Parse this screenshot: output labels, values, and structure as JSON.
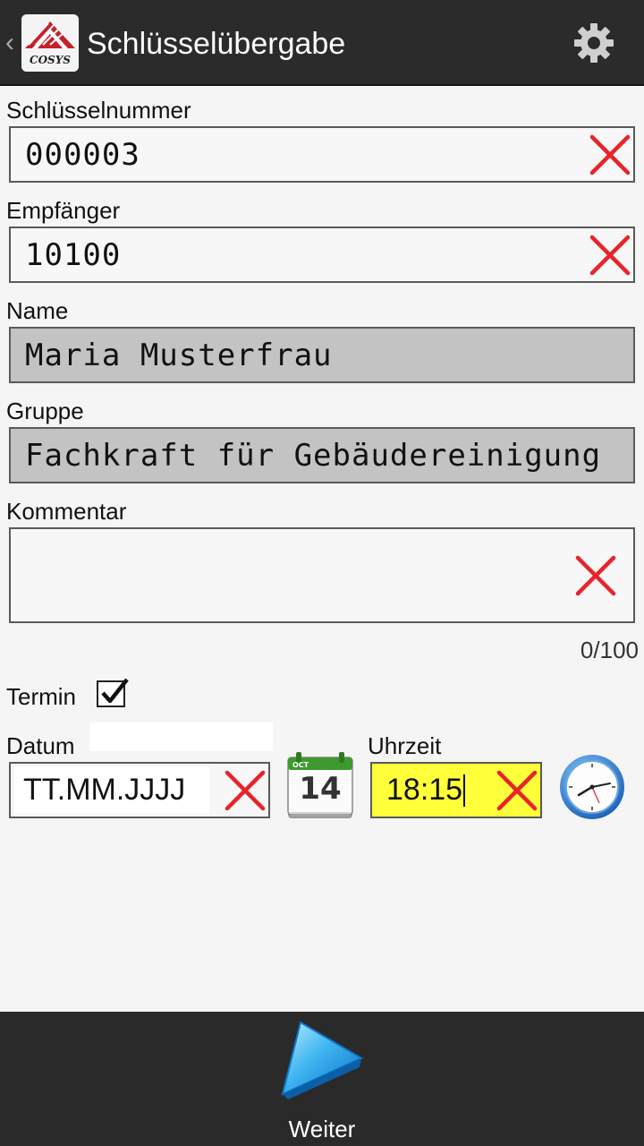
{
  "appbar": {
    "title": "Schlüsselübergabe",
    "logo_text": "COSYS"
  },
  "form": {
    "key_number": {
      "label": "Schlüsselnummer",
      "value": "000003"
    },
    "recipient": {
      "label": "Empfänger",
      "value": "10100"
    },
    "name": {
      "label": "Name",
      "value": "Maria Musterfrau"
    },
    "group": {
      "label": "Gruppe",
      "value": "Fachkraft für Gebäudereinigung"
    },
    "comment": {
      "label": "Kommentar",
      "value": "",
      "counter": "0/100"
    },
    "appointment": {
      "label": "Termin",
      "checked": true
    },
    "date": {
      "label": "Datum",
      "value": "TT.MM.JJJJ"
    },
    "time": {
      "label": "Uhrzeit",
      "value": "18:15"
    }
  },
  "calendar_icon": {
    "month": "OCT",
    "day": "14"
  },
  "bottom": {
    "next_label": "Weiter"
  },
  "colors": {
    "accent_clear": "#e8232a",
    "highlight_field": "#ffff3a",
    "appbar": "#2b2b2b"
  },
  "icons": [
    "back-chevron-icon",
    "app-logo-icon",
    "gear-icon",
    "clear-icon",
    "checkbox-icon",
    "calendar-icon",
    "clock-icon",
    "play-arrow-icon"
  ]
}
